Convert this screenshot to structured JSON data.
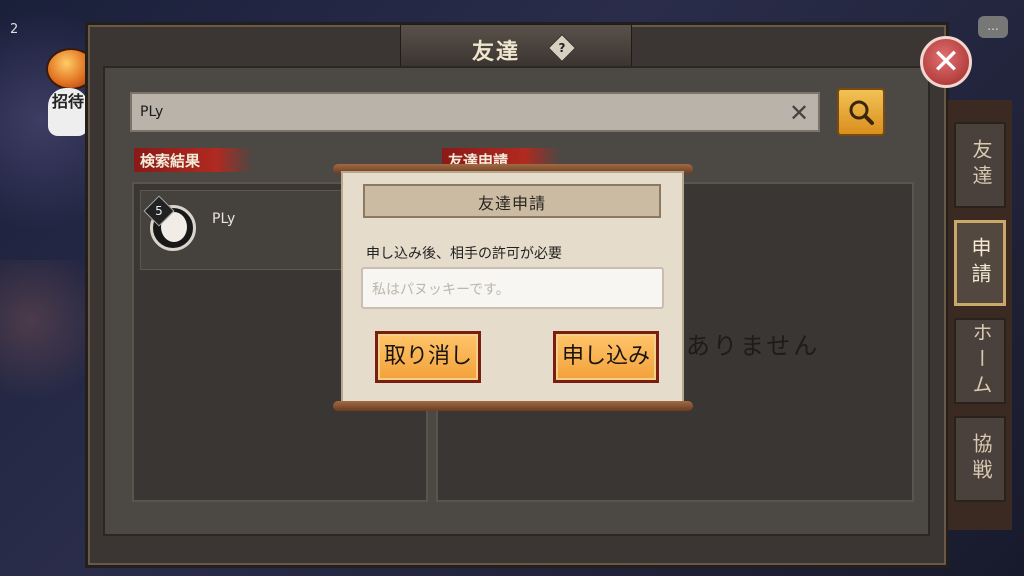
{
  "side_left": {
    "badge_count": "2",
    "invite_label": "招待"
  },
  "window": {
    "title": "友達",
    "help_glyph": "?"
  },
  "search": {
    "value": "PLy",
    "clear_glyph": "✕"
  },
  "results": {
    "tag": "検索結果",
    "items": [
      {
        "name": "PLy",
        "level": "5"
      }
    ]
  },
  "requests": {
    "tag": "友達申請",
    "empty_text": "ありません"
  },
  "right_tabs": [
    {
      "label": "友達",
      "active": false
    },
    {
      "label": "申請",
      "active": true
    },
    {
      "label": "ホーム",
      "active": false
    },
    {
      "label": "協戦",
      "active": false
    }
  ],
  "close_glyph": "✕",
  "chat_glyph": "...",
  "modal": {
    "title": "友達申請",
    "description": "申し込み後、相手の許可が必要",
    "input_placeholder": "私はパヌッキーです。",
    "cancel_label": "取り消し",
    "apply_label": "申し込み"
  },
  "colors": {
    "accent": "#f2a13a",
    "tag_red": "#b02a20",
    "close_red": "#c94545"
  }
}
